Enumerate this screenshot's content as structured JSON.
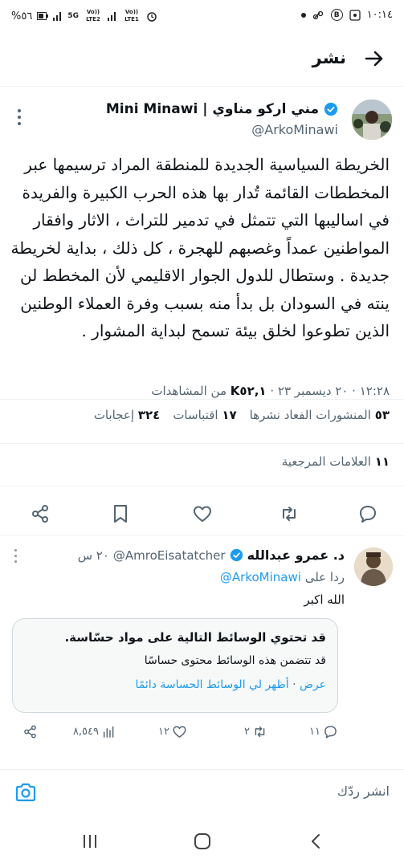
{
  "status_bar": {
    "time": "١٠:١٤",
    "battery": "%٥٦",
    "sim1_label": "Vo)) LTE2",
    "sim2_label": "Vo)) LTE1",
    "network": "5G"
  },
  "header": {
    "title": "نشر"
  },
  "tweet": {
    "author_name": "مني اركو مناوي | Mini Minawi",
    "author_handle": "@ArkoMinawi",
    "text_lines": [
      "الخريطة السياسية  الجديدة للمنطقة المراد ترسيمها عبر",
      "المخططات القائمة تُدار بها هذه الحرب الكبيرة والفريدة",
      "في اساليبها التي تتمثل في تدمير للتراث ، الاثار وافقار",
      "المواطنين عمداً وغصبهم للهجرة ، كل ذلك ، بداية لخريطة",
      "جديدة . وستطال للدول الجوار الاقليمي لأن المخطط لن",
      "ينته في السودان بل بدأ منه بسبب وفرة  العملاء الوطنين",
      "الذين تطوعوا لخلق بيئة تسمح لبداية المشوار ."
    ],
    "time_date": "١٢:٢٨ · ٢٠ ديسمبر ٢٣ · ",
    "views_count": "K٥٢,١",
    "views_label": " من المشاهدات",
    "reposts_count": "٥٣",
    "reposts_label": "المنشورات الفعاد نشرها",
    "quotes_count": "١٧",
    "quotes_label": "اقتباسات",
    "likes_count": "٣٢٤",
    "likes_label": "إعجابات",
    "bookmarks_count": "١١",
    "bookmarks_label": "العلامات المرجعية",
    "action_icons": [
      "reply-icon",
      "repost-icon",
      "like-icon",
      "bookmark-icon",
      "share-icon"
    ]
  },
  "reply": {
    "author_name": "د. عمرو عبدالله",
    "author_handle": "@AmroEisatatcher",
    "time": "٢٠ س",
    "replying_to_label": "ردا على",
    "replying_to_handle": "@ArkoMinawi",
    "text": "الله اكبر",
    "sensitive_title": "قد تحتوي الوسائط التالية على مواد حسّاسة.",
    "sensitive_desc": "قد تتضمن هذه الوسائط محتوى حساسًا",
    "sensitive_show": "عرض",
    "sensitive_always": "أظهر لي الوسائط الحساسة دائمًا",
    "replies": "١١",
    "reposts": "٢",
    "likes": "١٢",
    "views": "٨,٥٤٩"
  },
  "composer": {
    "placeholder": "انشر ردّك"
  },
  "colors": {
    "accent": "#1d9bf0",
    "text": "#0f1419",
    "secondary": "#536471",
    "border": "#eff3f4"
  }
}
